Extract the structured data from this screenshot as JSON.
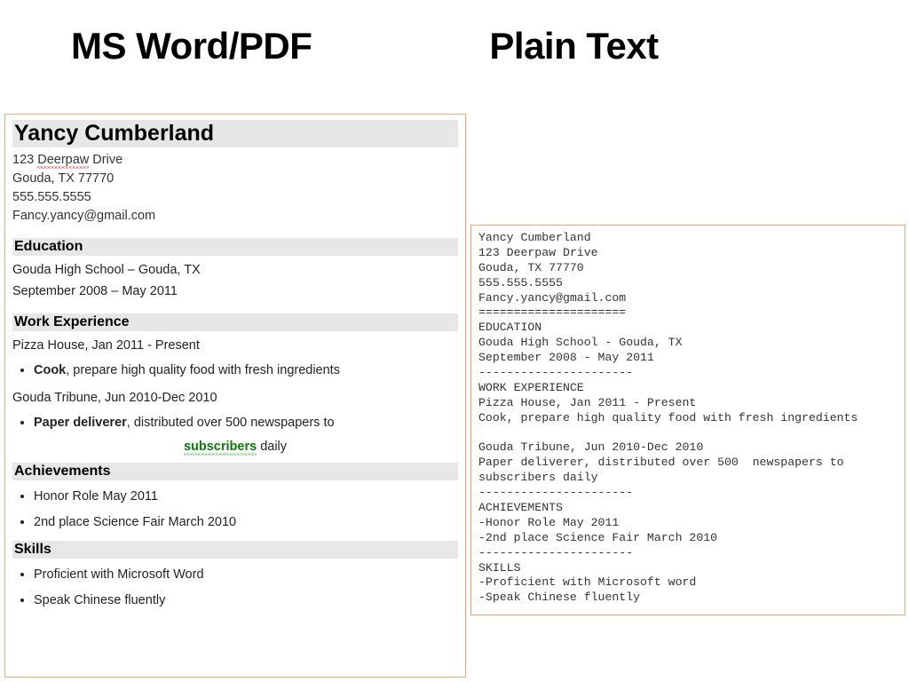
{
  "headings": {
    "left": "MS Word/PDF",
    "right": "Plain Text"
  },
  "resume": {
    "name": "Yancy Cumberland",
    "address_word": "Deerpaw",
    "address_pre": "123 ",
    "address_post": " Drive",
    "city": "Gouda, TX 77770",
    "phone": "555.555.5555",
    "email": "Fancy.yancy@gmail.com",
    "sections": {
      "education": {
        "title": "Education",
        "line1": "Gouda High School – Gouda, TX",
        "line2": "September 2008 – May 2011"
      },
      "work": {
        "title": "Work Experience",
        "job1_line": "Pizza House, Jan 2011 - Present",
        "job1_role": "Cook",
        "job1_desc": ", prepare high quality food with fresh ingredients",
        "job2_line": "Gouda Tribune, Jun 2010-Dec 2010",
        "job2_role": "Paper deliverer",
        "job2_desc": ", distributed over 500 newspapers to",
        "job2_sub": "subscribers",
        "job2_sub_after": " daily"
      },
      "achievements": {
        "title": "Achievements",
        "item1": "Honor Role May 2011",
        "item2": "2nd place Science Fair March 2010"
      },
      "skills": {
        "title": "Skills",
        "item1": "Proficient with Microsoft Word",
        "item2": "Speak Chinese fluently"
      }
    }
  },
  "plain_text": "Yancy Cumberland\n123 Deerpaw Drive\nGouda, TX 77770\n555.555.5555\nFancy.yancy@gmail.com\n=====================\nEDUCATION\nGouda High School - Gouda, TX\nSeptember 2008 - May 2011\n----------------------\nWORK EXPERIENCE\nPizza House, Jan 2011 - Present\nCook, prepare high quality food with fresh ingredients\n\nGouda Tribune, Jun 2010-Dec 2010\nPaper deliverer, distributed over 500  newspapers to\nsubscribers daily\n----------------------\nACHIEVEMENTS\n-Honor Role May 2011\n-2nd place Science Fair March 2010\n----------------------\nSKILLS\n-Proficient with Microsoft word\n-Speak Chinese fluently"
}
